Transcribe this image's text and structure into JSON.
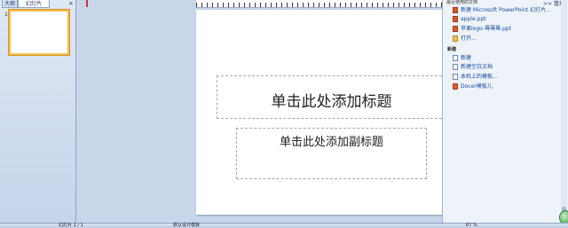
{
  "left_pane": {
    "tabs": [
      "大纲",
      "幻灯片"
    ],
    "close_glyph": "×",
    "thumbnail_number": "1"
  },
  "slide": {
    "title_placeholder": "单击此处添加标题",
    "subtitle_placeholder": "单击此处添加副标题"
  },
  "task_pane": {
    "header_fragment": "最近使用的文档",
    "nav_fragment": ">> 管理",
    "recent_items": [
      {
        "label": "新建 Microsoft PowerPoint 幻灯片...",
        "icon": "ppt-icon"
      },
      {
        "label": "apple.ppt",
        "icon": "ppt-icon"
      },
      {
        "label": "苹果logo-蓦蓦蓦.ppt",
        "icon": "ppt-icon"
      },
      {
        "label": "打开...",
        "icon": "folder-icon"
      }
    ],
    "new_section_label": "新建",
    "new_items": [
      {
        "label": "新建",
        "icon": "doc-icon"
      },
      {
        "label": "新建空白文档",
        "icon": "doc-icon"
      },
      {
        "label": "本机上的模板...",
        "icon": "doc-icon"
      },
      {
        "label": "Docer模板儿",
        "icon": "ie-icon"
      }
    ]
  },
  "status_bar": {
    "slide_info": "幻灯片 1 / 1",
    "theme": "默认设计模板",
    "zoom": "67 %"
  }
}
